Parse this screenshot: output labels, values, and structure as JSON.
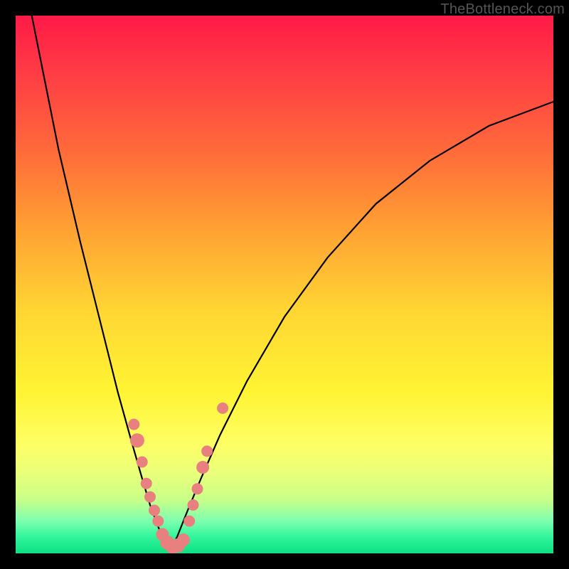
{
  "watermark": {
    "text": "TheBottleneck.com"
  },
  "chart_data": {
    "type": "line",
    "title": "",
    "xlabel": "",
    "ylabel": "",
    "xlim": [
      0,
      100
    ],
    "ylim": [
      0,
      100
    ],
    "grid": false,
    "legend": false,
    "background": "rainbow-vertical-gradient",
    "series": [
      {
        "name": "left-curve",
        "x": [
          3,
          5,
          8,
          12,
          16,
          19,
          21.5,
          23.5,
          25,
          26.5,
          27.5,
          28.5
        ],
        "y": [
          100,
          90,
          75,
          58,
          42,
          30,
          21,
          14,
          9,
          5,
          2.5,
          0.5
        ]
      },
      {
        "name": "right-curve",
        "x": [
          28.5,
          30,
          32,
          34.5,
          38,
          43,
          50,
          58,
          67,
          77,
          88,
          100
        ],
        "y": [
          0.5,
          3,
          8,
          14,
          22,
          32,
          44,
          55,
          65,
          73,
          79.5,
          84
        ]
      }
    ],
    "markers": [
      {
        "name": "left-cluster",
        "x": 22.0,
        "y": 24,
        "r": 8
      },
      {
        "name": "left-cluster",
        "x": 22.6,
        "y": 21,
        "r": 10
      },
      {
        "name": "left-cluster",
        "x": 23.5,
        "y": 17,
        "r": 8
      },
      {
        "name": "left-cluster",
        "x": 24.3,
        "y": 13,
        "r": 8
      },
      {
        "name": "left-cluster",
        "x": 25.0,
        "y": 10.5,
        "r": 8
      },
      {
        "name": "left-cluster",
        "x": 25.8,
        "y": 8,
        "r": 8
      },
      {
        "name": "left-cluster",
        "x": 26.5,
        "y": 6,
        "r": 8
      },
      {
        "name": "bottom-cluster",
        "x": 27.3,
        "y": 3.5,
        "r": 9
      },
      {
        "name": "bottom-cluster",
        "x": 28.2,
        "y": 2,
        "r": 10
      },
      {
        "name": "bottom-cluster",
        "x": 29.2,
        "y": 1.2,
        "r": 10
      },
      {
        "name": "bottom-cluster",
        "x": 30.2,
        "y": 1.5,
        "r": 10
      },
      {
        "name": "bottom-cluster",
        "x": 31.2,
        "y": 2.5,
        "r": 9
      },
      {
        "name": "right-cluster",
        "x": 32.3,
        "y": 6,
        "r": 8
      },
      {
        "name": "right-cluster",
        "x": 33.0,
        "y": 9,
        "r": 8
      },
      {
        "name": "right-cluster",
        "x": 33.8,
        "y": 12,
        "r": 8
      },
      {
        "name": "right-cluster",
        "x": 34.8,
        "y": 16,
        "r": 9
      },
      {
        "name": "right-cluster",
        "x": 35.6,
        "y": 19,
        "r": 8
      },
      {
        "name": "right-outlier",
        "x": 38.5,
        "y": 27,
        "r": 8
      }
    ],
    "marker_color": "#e98080"
  }
}
